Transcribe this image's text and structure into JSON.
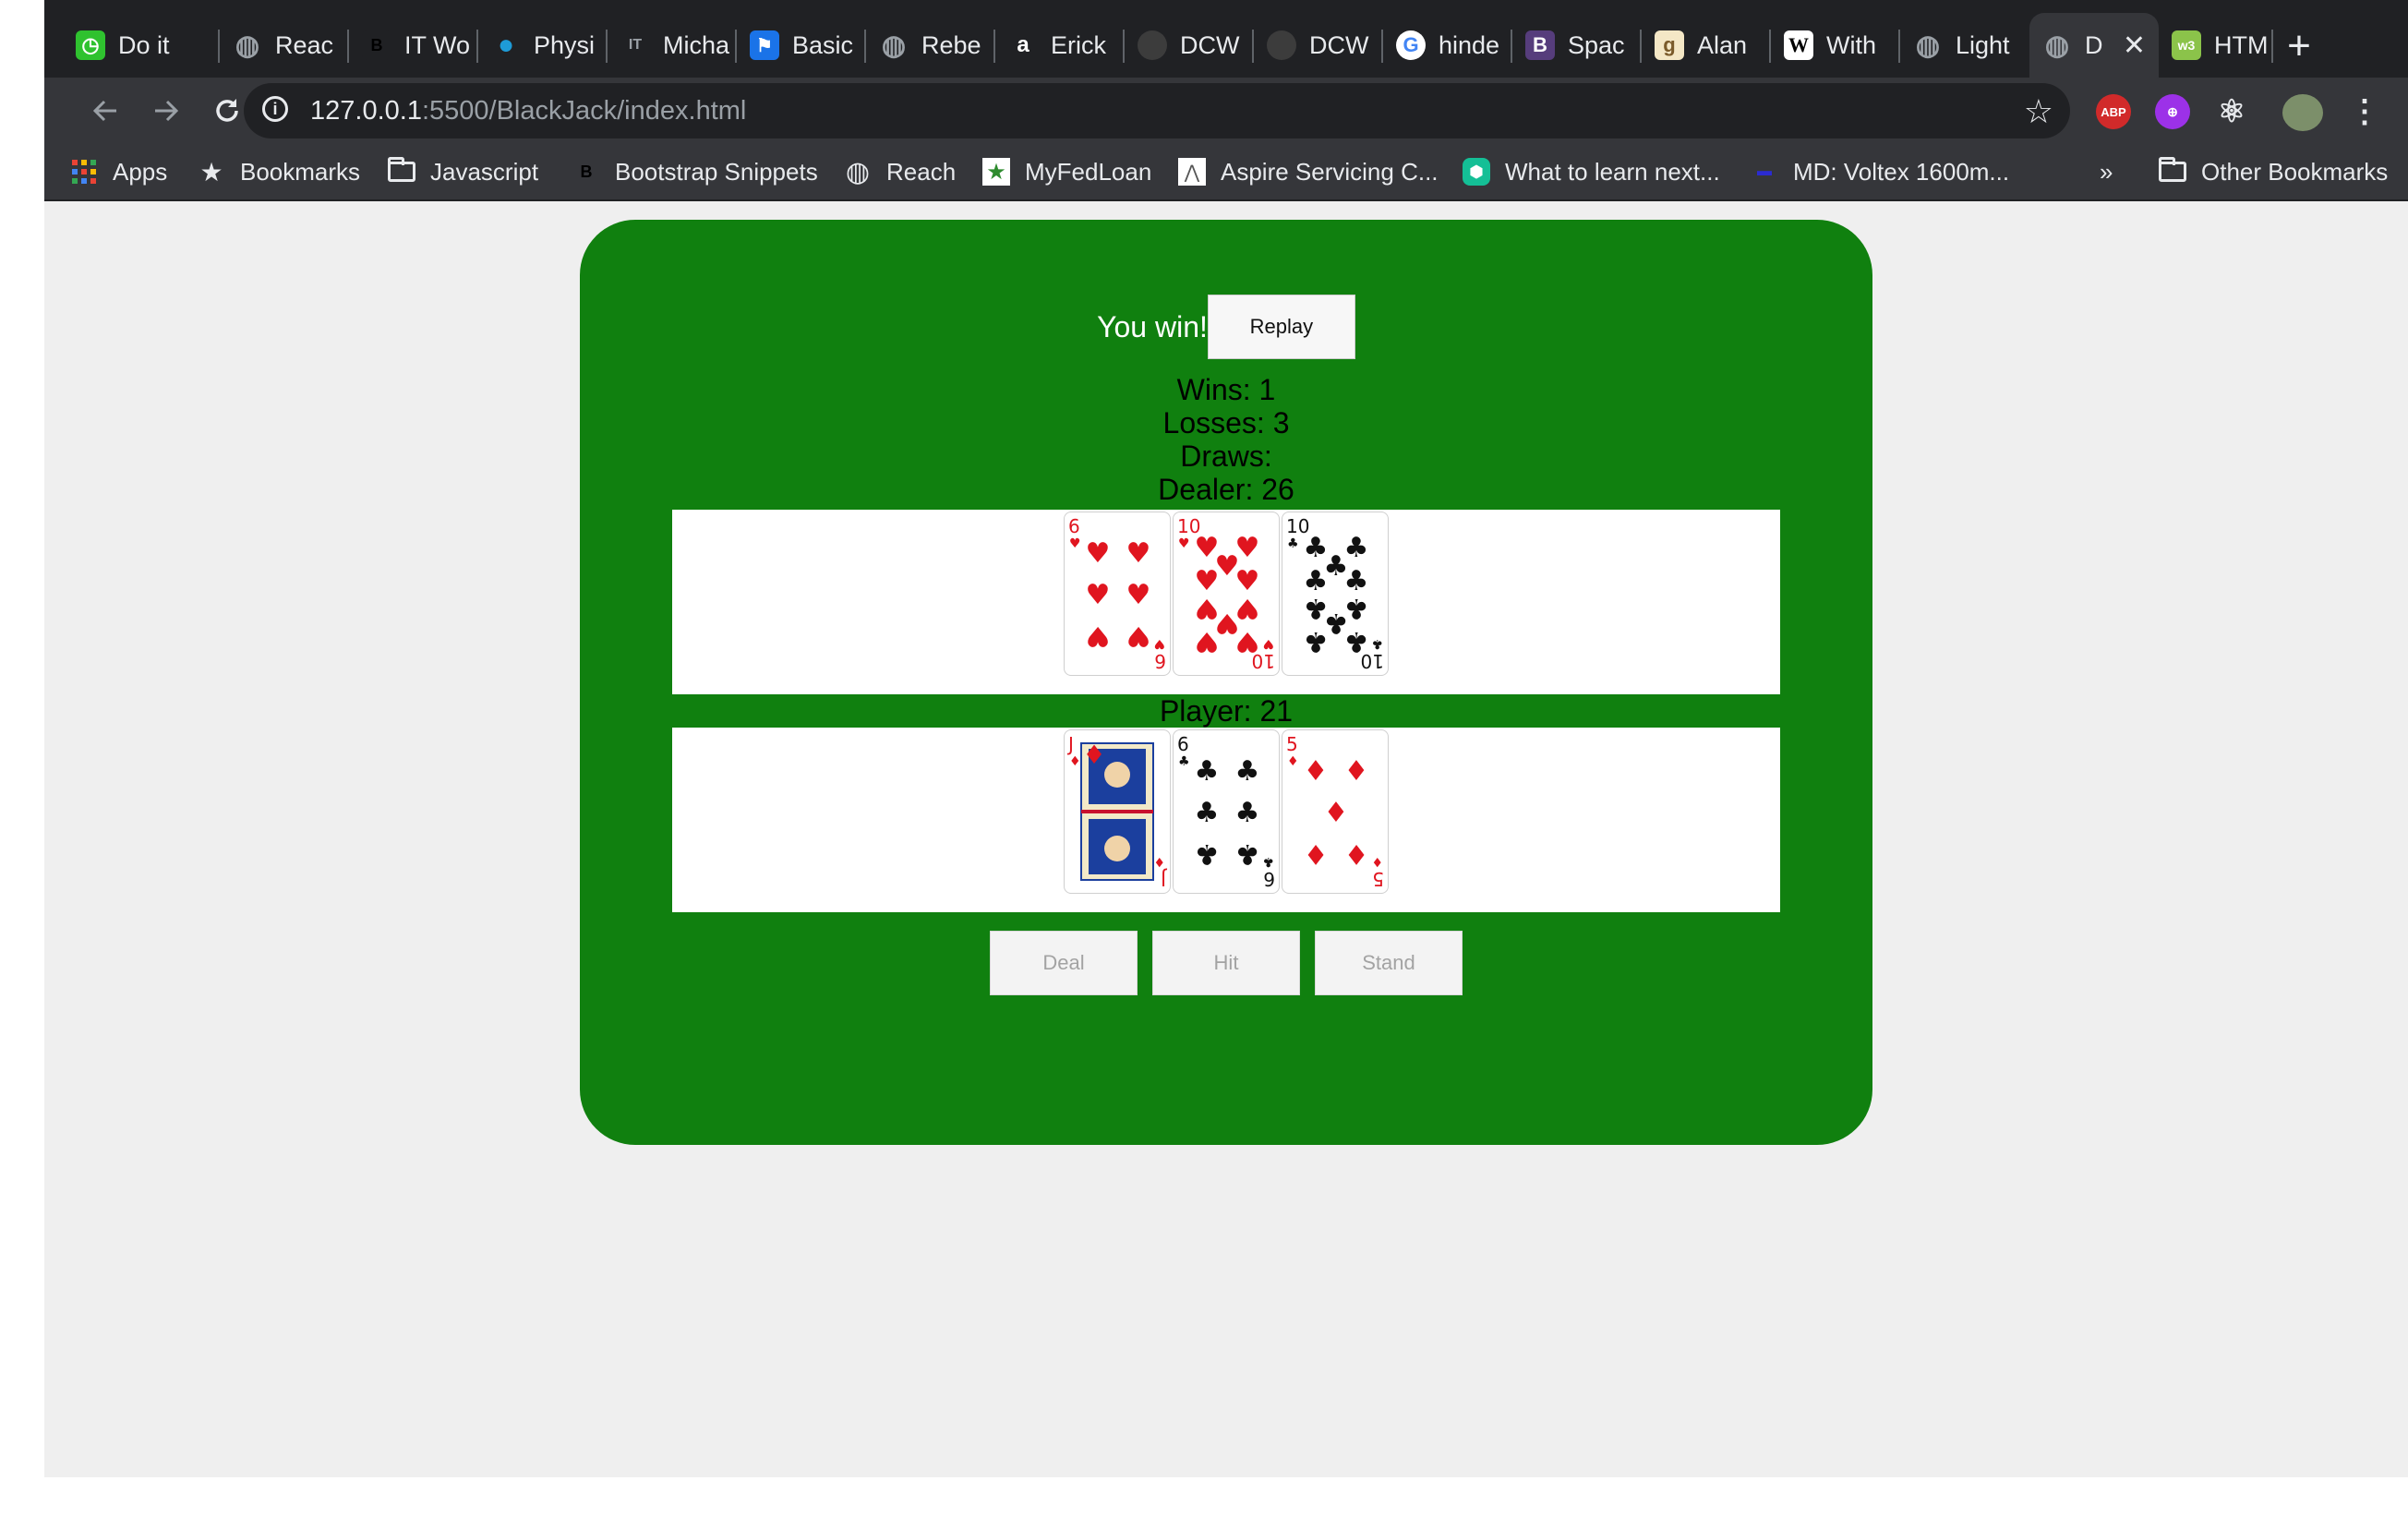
{
  "browser": {
    "tabs": [
      {
        "title": "Do it",
        "icon": "green-clock-icon"
      },
      {
        "title": "Reac",
        "icon": "globe-icon"
      },
      {
        "title": "IT Wo",
        "icon": "b-letter-icon"
      },
      {
        "title": "Physi",
        "icon": "chat-bubble-icon"
      },
      {
        "title": "Micha",
        "icon": "it-letter-icon"
      },
      {
        "title": "Basic",
        "icon": "flag-icon"
      },
      {
        "title": "Rebe",
        "icon": "globe-icon"
      },
      {
        "title": "Erick",
        "icon": "a-letter-icon"
      },
      {
        "title": "DCW",
        "icon": "github-icon"
      },
      {
        "title": "DCW",
        "icon": "github-icon"
      },
      {
        "title": "hinde",
        "icon": "google-icon"
      },
      {
        "title": "Spac",
        "icon": "bootstrap-icon"
      },
      {
        "title": "Alan",
        "icon": "g-letter-icon"
      },
      {
        "title": "With",
        "icon": "wikipedia-icon"
      },
      {
        "title": "Light",
        "icon": "globe-icon"
      },
      {
        "title": "D",
        "icon": "globe-icon"
      },
      {
        "title": "HTM",
        "icon": "w3-icon"
      }
    ],
    "url_host": "127.0.0.1",
    "url_path": ":5500/BlackJack/index.html",
    "ext_abp": "ABP",
    "bookmarks": [
      {
        "label": "Apps",
        "icon": "apps-grid-icon"
      },
      {
        "label": "Bookmarks",
        "icon": "star-icon"
      },
      {
        "label": "Javascript",
        "icon": "folder-icon"
      },
      {
        "label": "Bootstrap Snippets",
        "icon": "b-letter-icon"
      },
      {
        "label": "Reach",
        "icon": "globe-icon"
      },
      {
        "label": "MyFedLoan",
        "icon": "fedloan-icon"
      },
      {
        "label": "Aspire Servicing C...",
        "icon": "aspire-icon"
      },
      {
        "label": "What to learn next...",
        "icon": "khan-icon"
      },
      {
        "label": "MD: Voltex 1600m...",
        "icon": "md-icon"
      }
    ],
    "overflow": "»",
    "other_bookmarks": "Other Bookmarks"
  },
  "game": {
    "result": "You win!",
    "replay_label": "Replay",
    "wins": "Wins: 1",
    "losses": "Losses: 3",
    "draws": "Draws:",
    "dealer_label": "Dealer: 26",
    "player_label": "Player: 21",
    "dealer_cards": [
      {
        "rank": "6",
        "suit": "hearts"
      },
      {
        "rank": "10",
        "suit": "hearts"
      },
      {
        "rank": "10",
        "suit": "clubs"
      }
    ],
    "player_cards": [
      {
        "rank": "J",
        "suit": "diamonds"
      },
      {
        "rank": "6",
        "suit": "clubs"
      },
      {
        "rank": "5",
        "suit": "diamonds"
      }
    ],
    "buttons": {
      "deal": "Deal",
      "hit": "Hit",
      "stand": "Stand"
    }
  },
  "colors": {
    "felt": "#10800f",
    "red_suit": "#e0151f",
    "black_suit": "#111111"
  }
}
